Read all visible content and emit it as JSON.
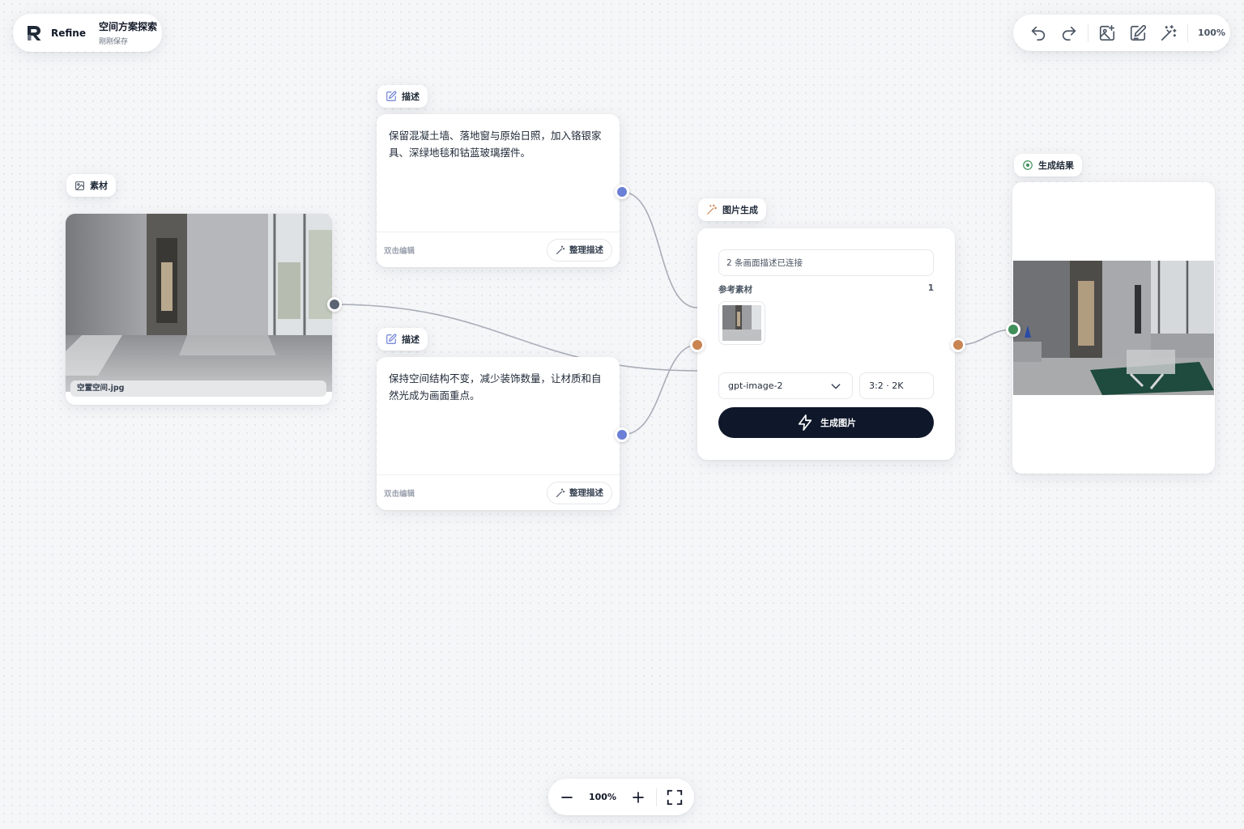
{
  "app": {
    "brand": "Refine",
    "project_title": "空间方案探索",
    "save_status": "刚刚保存"
  },
  "toolbar": {
    "undo_icon": "undo-icon",
    "redo_icon": "redo-icon",
    "add_image_icon": "image-plus-icon",
    "add_text_icon": "edit-note-icon",
    "add_generate_icon": "magic-wand-icon",
    "zoom": "100%"
  },
  "nodes": {
    "material": {
      "label": "素材",
      "filename": "空置空间.jpg"
    },
    "description_1": {
      "label": "描述",
      "text": "保留混凝土墙、落地窗与原始日照，加入铬银家具、深绿地毯和钴蓝玻璃摆件。",
      "hint": "双击编辑",
      "tidy": "整理描述"
    },
    "description_2": {
      "label": "描述",
      "text": "保持空间结构不变，减少装饰数量，让材质和自然光成为画面重点。",
      "hint": "双击编辑",
      "tidy": "整理描述"
    },
    "generate": {
      "label": "图片生成",
      "status": "2 条画面描述已连接",
      "ref_label": "参考素材",
      "ref_count": "1",
      "model": "gpt-image-2",
      "ratio": "3:2 · 2K",
      "button": "生成图片"
    },
    "result": {
      "label": "生成结果"
    }
  },
  "zoom_bar": {
    "value": "100%"
  },
  "colors": {
    "port_text": "#6b7fd6",
    "port_image": "#5b6472",
    "port_generate": "#c98452",
    "port_result": "#3f8f5a",
    "button_dark": "#0f172a"
  }
}
